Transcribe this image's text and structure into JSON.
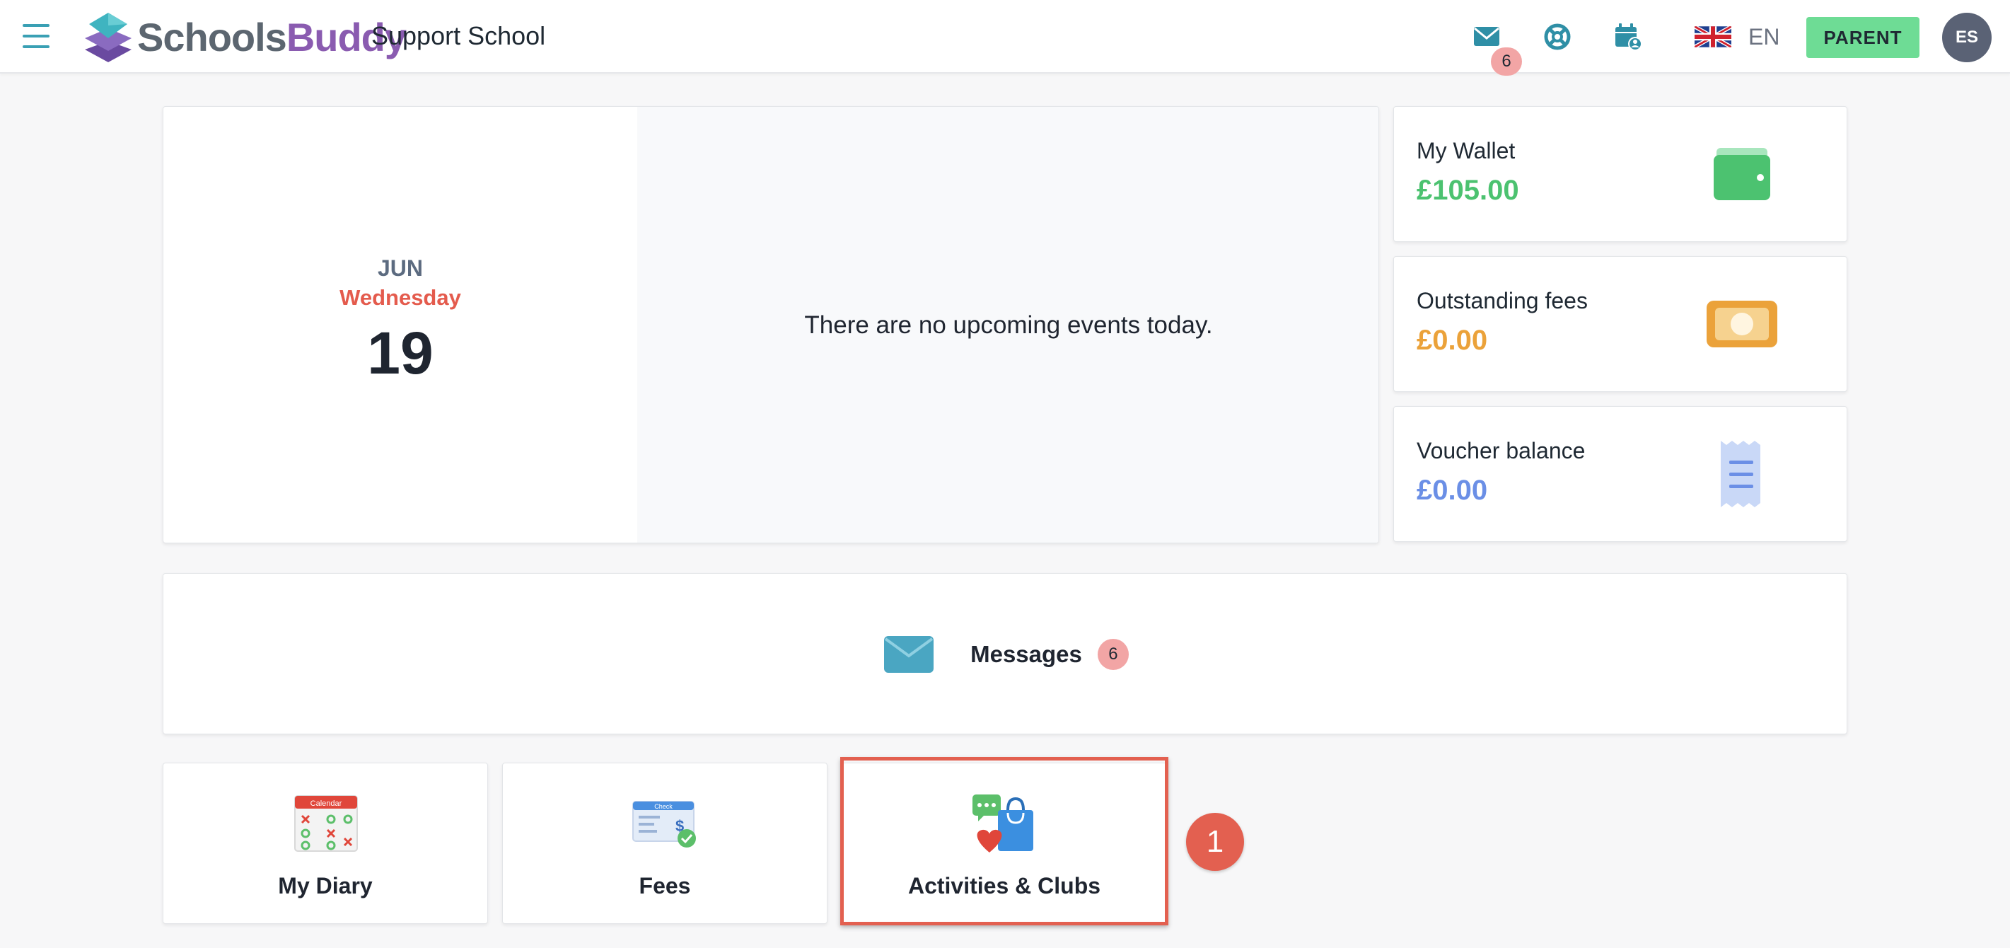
{
  "header": {
    "logo": {
      "part1": "Schools",
      "part2": "Buddy"
    },
    "school_name": "Support School",
    "mail_count": "6",
    "language_code": "EN",
    "role_button": "PARENT",
    "avatar_initials": "ES"
  },
  "date_card": {
    "month": "JUN",
    "weekday": "Wednesday",
    "day": "19",
    "no_events_text": "There are no upcoming events today."
  },
  "finance": {
    "wallet": {
      "label": "My Wallet",
      "value": "£105.00",
      "color": "#4cc270"
    },
    "fees": {
      "label": "Outstanding fees",
      "value": "£0.00",
      "color": "#eba23a"
    },
    "voucher": {
      "label": "Voucher balance",
      "value": "£0.00",
      "color": "#6b8fe6"
    }
  },
  "messages": {
    "label": "Messages",
    "count": "6"
  },
  "tiles": [
    {
      "label": "My Diary",
      "icon": "calendar-icon",
      "icon_text": "Calendar"
    },
    {
      "label": "Fees",
      "icon": "cheque-icon",
      "icon_text": "Check"
    },
    {
      "label": "Activities & Clubs",
      "icon": "shopping-bag-icon"
    }
  ],
  "annotation": {
    "step_number": "1"
  },
  "colors": {
    "accent": "#3aa0b4",
    "parent_button": "#6edc95",
    "badge": "#f2a5a5",
    "highlight": "#e36050",
    "weekday": "#e45b4d"
  }
}
